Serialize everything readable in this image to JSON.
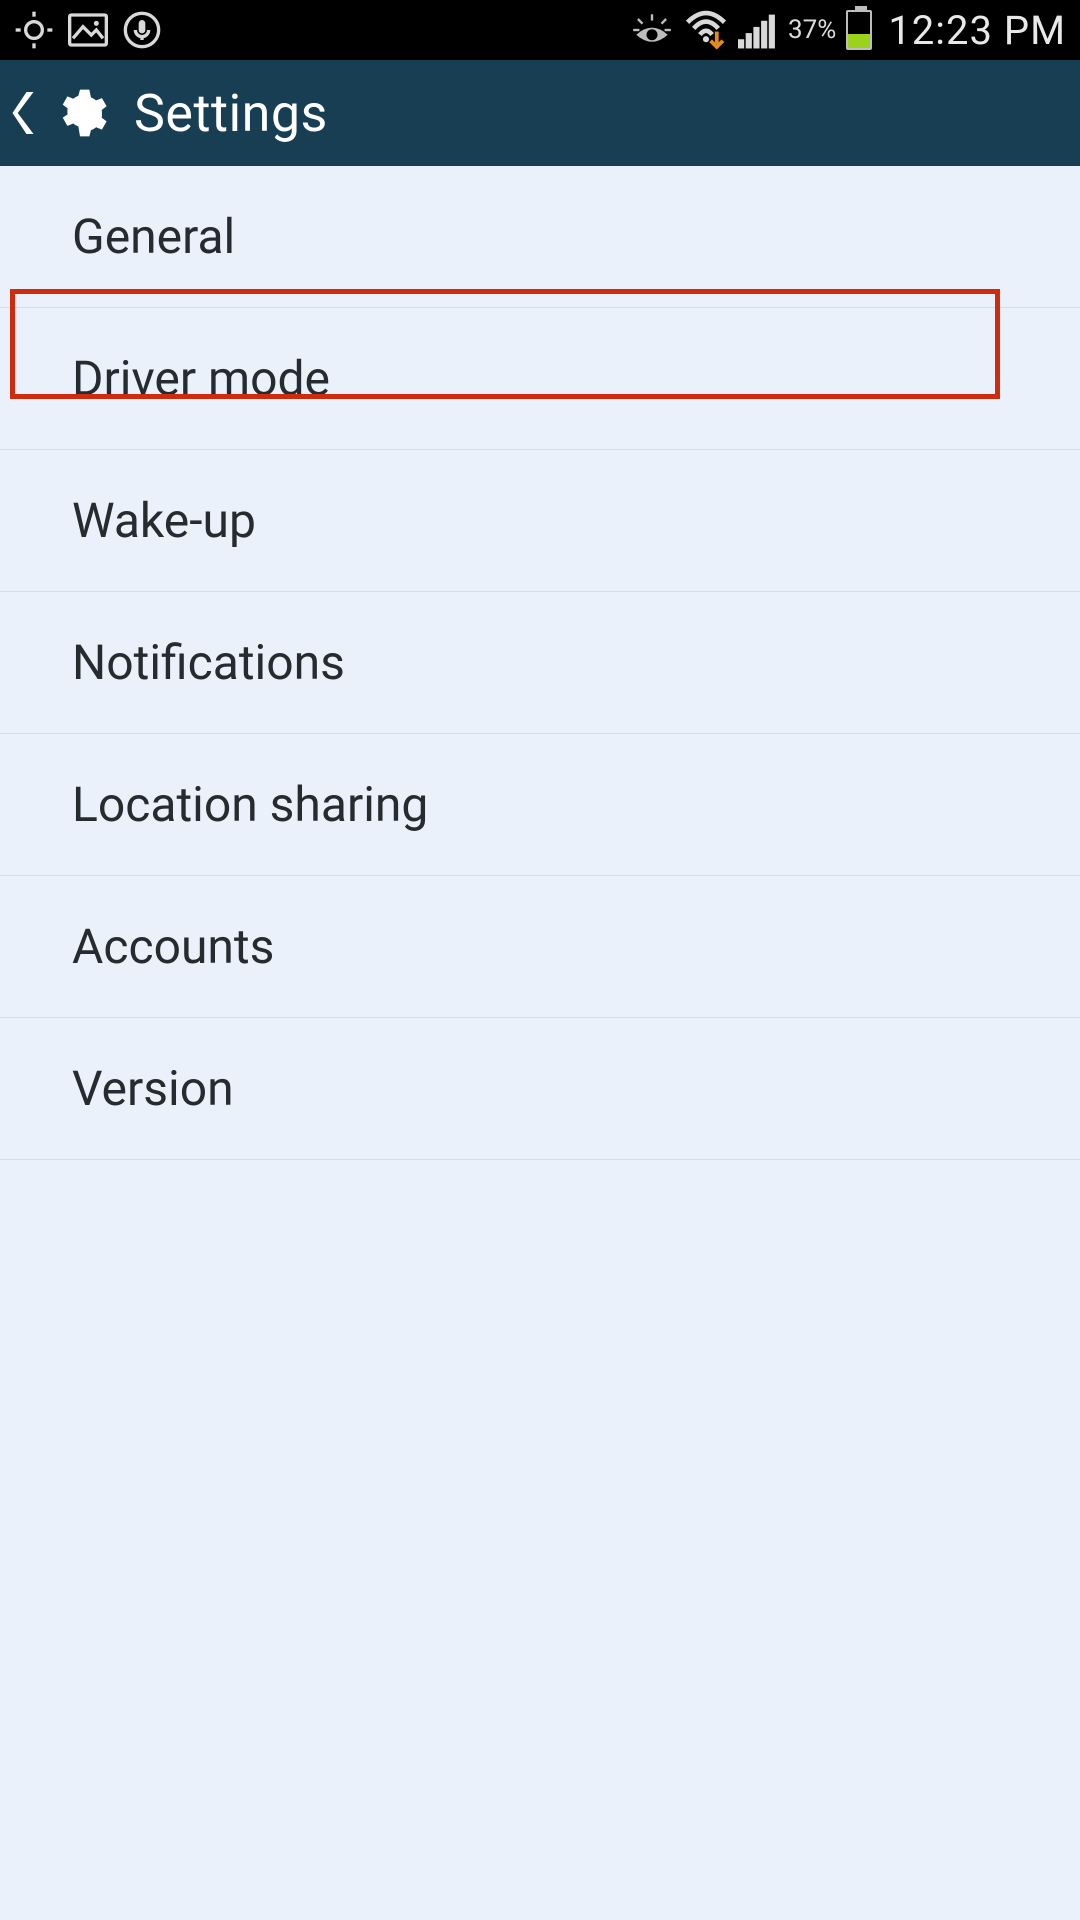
{
  "status_bar": {
    "icons_left": [
      "gps-icon",
      "image-icon",
      "voice-icon"
    ],
    "icons_right": [
      "smart-stay-icon",
      "wifi-download-icon",
      "signal-icon"
    ],
    "battery_percent_text": "37%",
    "battery_fill_percent": 40,
    "time": "12:23 PM"
  },
  "action_bar": {
    "title": "Settings"
  },
  "settings_items": [
    {
      "label": "General"
    },
    {
      "label": "Driver mode"
    },
    {
      "label": "Wake-up"
    },
    {
      "label": "Notifications"
    },
    {
      "label": "Location sharing"
    },
    {
      "label": "Accounts"
    },
    {
      "label": "Version"
    }
  ],
  "highlight": {
    "target_label": "Driver mode"
  },
  "colors": {
    "status_bg": "#000000",
    "actionbar_bg": "#173e53",
    "list_bg": "#eaf1fb",
    "divider": "#d5dde7",
    "text": "#262b2f",
    "highlight_border": "#cf2c0f",
    "battery_fill": "#9ad31a"
  }
}
